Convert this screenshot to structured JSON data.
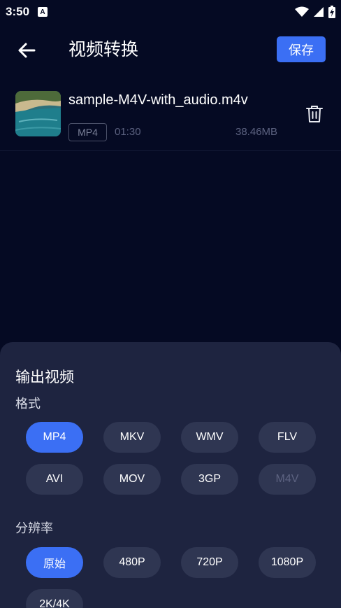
{
  "status_bar": {
    "time": "3:50",
    "notification_glyph": "A"
  },
  "header": {
    "title": "视频转换",
    "save_label": "保存"
  },
  "file": {
    "name": "sample-M4V-with_audio.m4v",
    "format_badge": "MP4",
    "duration": "01:30",
    "size": "38.46MB"
  },
  "sheet": {
    "title": "输出视频",
    "format_label": "格式",
    "formats": [
      {
        "label": "MP4",
        "state": "selected"
      },
      {
        "label": "MKV",
        "state": "normal"
      },
      {
        "label": "WMV",
        "state": "normal"
      },
      {
        "label": "FLV",
        "state": "normal"
      },
      {
        "label": "AVI",
        "state": "normal"
      },
      {
        "label": "MOV",
        "state": "normal"
      },
      {
        "label": "3GP",
        "state": "normal"
      },
      {
        "label": "M4V",
        "state": "disabled"
      }
    ],
    "resolution_label": "分辨率",
    "resolutions": [
      {
        "label": "原始",
        "state": "selected"
      },
      {
        "label": "480P",
        "state": "normal"
      },
      {
        "label": "720P",
        "state": "normal"
      },
      {
        "label": "1080P",
        "state": "normal"
      },
      {
        "label": "2K/4K",
        "state": "normal"
      }
    ]
  },
  "colors": {
    "background": "#050a23",
    "sheet": "#1e2440",
    "chip": "#2f3652",
    "accent": "#3b6ff4"
  }
}
